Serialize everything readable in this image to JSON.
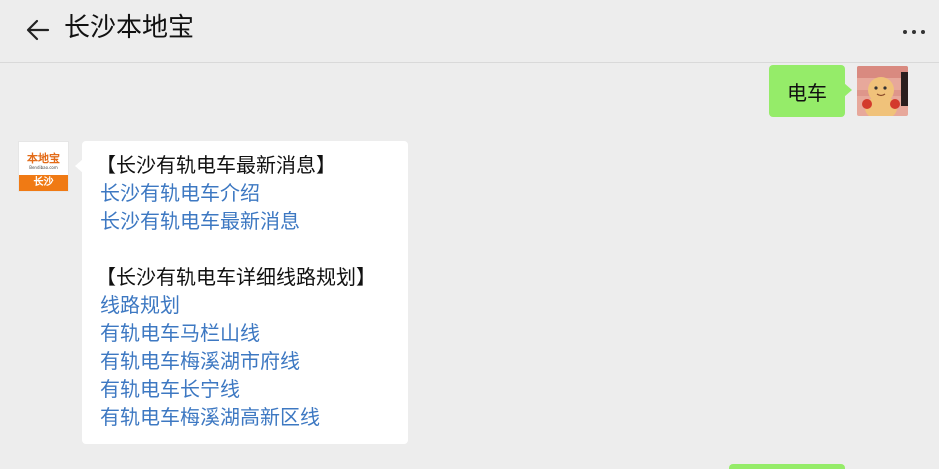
{
  "header": {
    "title": "长沙本地宝"
  },
  "sent_message": {
    "text": "电车"
  },
  "bot": {
    "avatar_logo": "本地宝",
    "avatar_url": "Bendibao.com",
    "avatar_city": "长沙"
  },
  "received_message": {
    "section1_title": "【长沙有轨电车最新消息】",
    "section1_links": [
      "长沙有轨电车介绍",
      "长沙有轨电车最新消息"
    ],
    "section2_title": "【长沙有轨电车详细线路规划】",
    "section2_links": [
      "线路规划",
      "有轨电车马栏山线",
      "有轨电车梅溪湖市府线",
      "有轨电车长宁线",
      "有轨电车梅溪湖高新区线"
    ]
  },
  "icons": {
    "back": "back-arrow-icon",
    "more": "more-dots-icon"
  },
  "colors": {
    "background": "#ededed",
    "sent_bubble": "#95ec69",
    "received_bubble": "#ffffff",
    "link": "#3d78c2",
    "brand_orange": "#f07a14"
  }
}
